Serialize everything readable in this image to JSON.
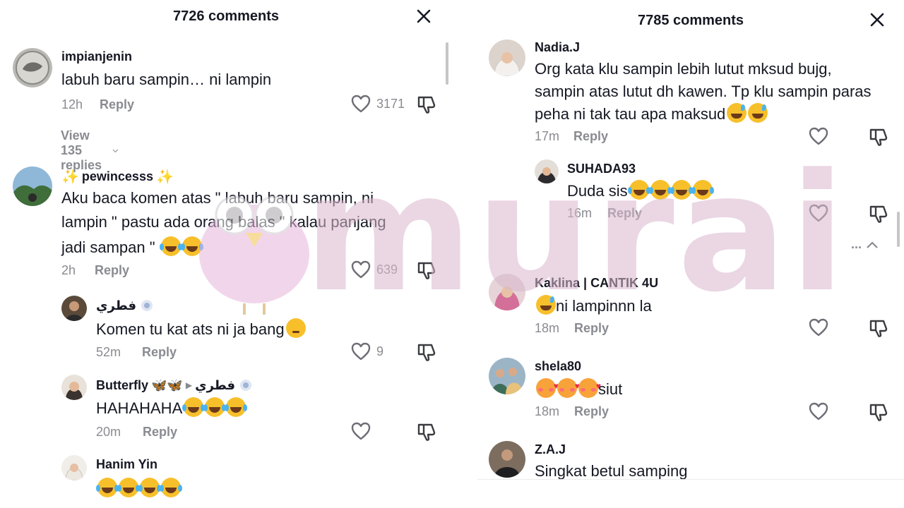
{
  "left": {
    "header": {
      "title": "7726 comments"
    },
    "comments": [
      {
        "user": "impianjenin",
        "text": [
          "labuh baru sampin… ni lampin"
        ],
        "time": "12h",
        "reply": "Reply",
        "likes": "3171",
        "view_replies": "View 135 replies"
      },
      {
        "user": "pewincesss",
        "text": [
          "Aku baca komen atas \" labuh baru sampin, ni",
          "lampin \" pastu ada orang balas \" kalau panjang",
          "jadi sampan \""
        ],
        "time": "2h",
        "reply": "Reply",
        "likes": "639"
      },
      {
        "user": "فطري",
        "text": [
          "Komen tu kat ats ni ja bang"
        ],
        "time": "52m",
        "reply": "Reply",
        "likes": "9"
      },
      {
        "user": "Butterfly",
        "reply_to": "فطري",
        "text": [
          "HAHAHAHA"
        ],
        "time": "20m",
        "reply": "Reply",
        "likes": ""
      },
      {
        "user": "Hanim Yin",
        "text": [
          ""
        ]
      }
    ]
  },
  "right": {
    "header": {
      "title": "7785 comments"
    },
    "comments": [
      {
        "user": "Nadia.J",
        "text": [
          "Org kata klu sampin lebih lutut mksud bujg,",
          "sampin atas lutut dh kawen. Tp klu sampin paras",
          "peha ni tak tau apa maksud"
        ],
        "time": "17m",
        "reply": "Reply"
      },
      {
        "user": "SUHADA93",
        "text": [
          "Duda sis"
        ],
        "time": "16m",
        "reply": "Reply"
      },
      {
        "user": "Kaklina | CANTIK 4U",
        "text": [
          "ni lampinnn la"
        ],
        "time": "18m",
        "reply": "Reply"
      },
      {
        "user": "shela80",
        "text": [
          "siut"
        ],
        "time": "18m",
        "reply": "Reply"
      },
      {
        "user": "Z.A.J",
        "text": [
          "Singkat betul samping"
        ]
      }
    ],
    "collapse_label": "..."
  },
  "watermark": {
    "text": "murai"
  },
  "icons": {
    "close": "close-icon",
    "like": "heart-outline-icon",
    "dislike": "thumbs-down-icon",
    "chevron": "chevron-down-icon",
    "sparkle": "sparkle-emoji",
    "badge": "verified-badge-icon"
  },
  "colors": {
    "text": "#161823",
    "muted": "#8a8b91",
    "watermark": "#d9b8cd"
  }
}
